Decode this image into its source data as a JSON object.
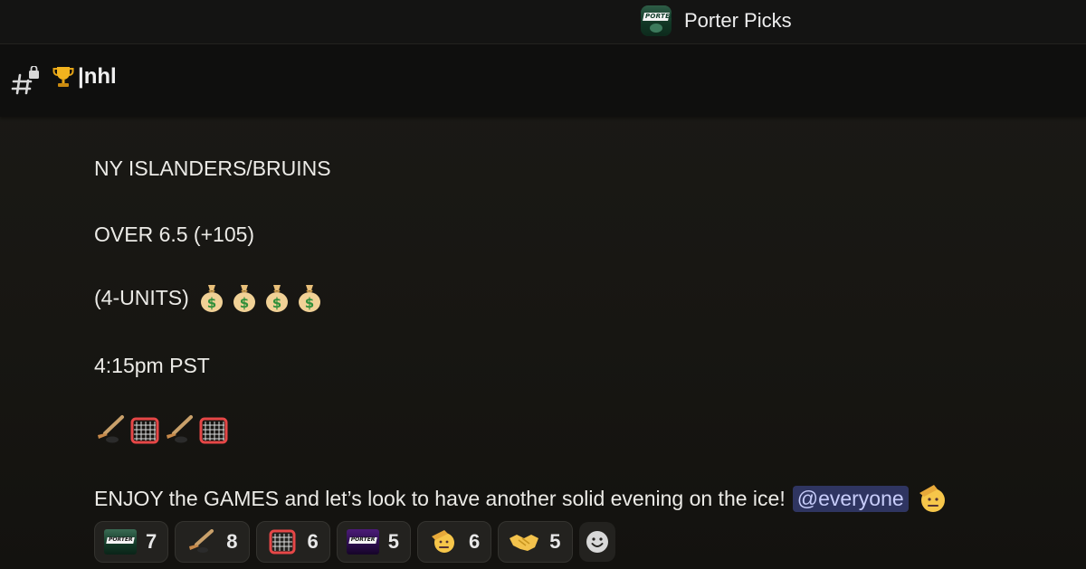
{
  "server": {
    "name": "Porter Picks",
    "icon": "porter-logo"
  },
  "channel": {
    "icon": "locked-hash-icon",
    "emoji": "trophy",
    "name": "|nhl"
  },
  "message": {
    "lines": [
      "NY ISLANDERS/BRUINS",
      "OVER 6.5 (+105)",
      "(4-UNITS)",
      "4:15pm PST"
    ],
    "closing_text": "ENJOY the GAMES and let’s look to have another solid evening on the ice!",
    "mention": "@everyone"
  },
  "reactions": [
    {
      "emoji": "porter-logo",
      "count": "7"
    },
    {
      "emoji": "ice-hockey",
      "count": "8"
    },
    {
      "emoji": "goal-net",
      "count": "6"
    },
    {
      "emoji": "porter-logo-purple",
      "count": "5"
    },
    {
      "emoji": "saluting-face",
      "count": "6"
    },
    {
      "emoji": "handshake",
      "count": "5"
    }
  ],
  "colors": {
    "background": "#181714",
    "mention_bg": "#2f3561",
    "mention_text": "#c8cdfa"
  }
}
